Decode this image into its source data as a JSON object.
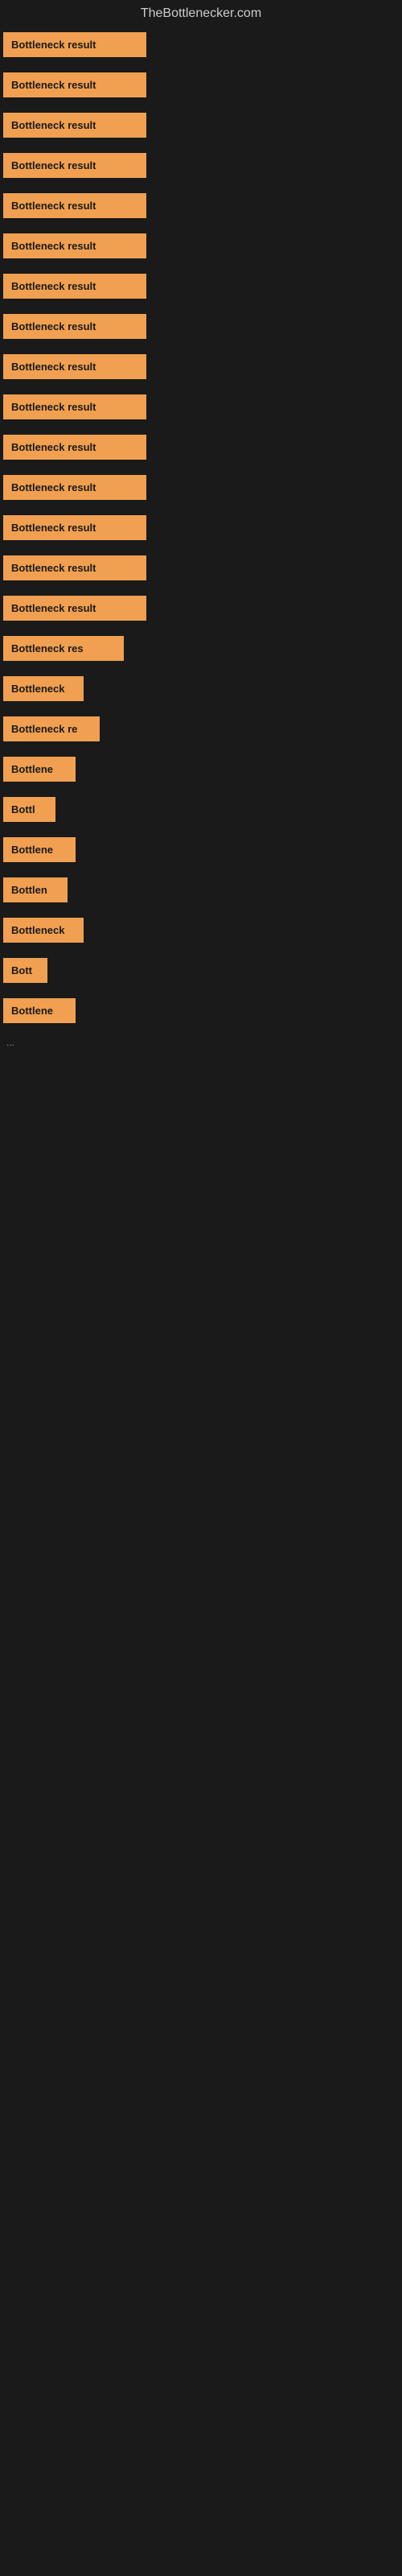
{
  "site": {
    "title": "TheBottlenecker.com"
  },
  "items": [
    {
      "label": "Bottleneck result",
      "width": 178
    },
    {
      "label": "Bottleneck result",
      "width": 178
    },
    {
      "label": "Bottleneck result",
      "width": 178
    },
    {
      "label": "Bottleneck result",
      "width": 178
    },
    {
      "label": "Bottleneck result",
      "width": 178
    },
    {
      "label": "Bottleneck result",
      "width": 178
    },
    {
      "label": "Bottleneck result",
      "width": 178
    },
    {
      "label": "Bottleneck result",
      "width": 178
    },
    {
      "label": "Bottleneck result",
      "width": 178
    },
    {
      "label": "Bottleneck result",
      "width": 178
    },
    {
      "label": "Bottleneck result",
      "width": 178
    },
    {
      "label": "Bottleneck result",
      "width": 178
    },
    {
      "label": "Bottleneck result",
      "width": 178
    },
    {
      "label": "Bottleneck result",
      "width": 178
    },
    {
      "label": "Bottleneck result",
      "width": 178
    },
    {
      "label": "Bottleneck res",
      "width": 150
    },
    {
      "label": "Bottleneck",
      "width": 100
    },
    {
      "label": "Bottleneck re",
      "width": 120
    },
    {
      "label": "Bottlene",
      "width": 90
    },
    {
      "label": "Bottl",
      "width": 65
    },
    {
      "label": "Bottlene",
      "width": 90
    },
    {
      "label": "Bottlen",
      "width": 80
    },
    {
      "label": "Bottleneck",
      "width": 100
    },
    {
      "label": "Bott",
      "width": 55
    },
    {
      "label": "Bottlene",
      "width": 90
    }
  ],
  "ellipsis": "..."
}
